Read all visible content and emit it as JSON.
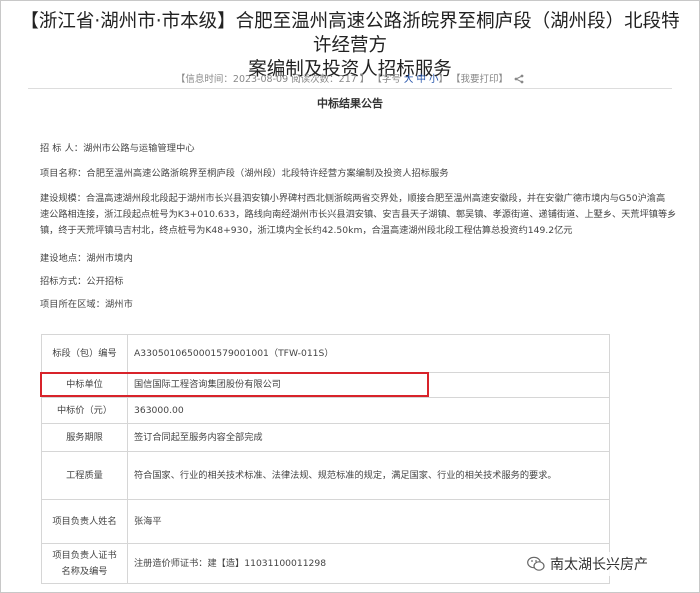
{
  "article": {
    "title_line1": "【浙江省·湖州市·市本级】合肥至温州高速公路浙皖界至桐庐段（湖州段）北段特许经营方",
    "title_line2": "案编制及投资人招标服务",
    "meta": {
      "info_time": "【信息时间：2023-08-09",
      "views": "阅读次数：217 】",
      "font_prefix": "【字号",
      "font_large": "大",
      "font_medium": "中",
      "font_small": "小",
      "font_suffix": "】",
      "print": "【我要打印】"
    },
    "notice_title": "中标结果公告"
  },
  "fields": {
    "tenderer": "招  标  人：湖州市公路与运输管理中心",
    "project_name": "项目名称：合肥至温州高速公路浙皖界至桐庐段（湖州段）北段特许经营方案编制及投资人招标服务",
    "scale_lines": [
      "建设规模：合温高速湖州段北段起于湖州市长兴县泗安镇小界碑村西北侧浙皖两省交界处，顺接合肥至温州高速安徽段，并在安徽广德市境内与G50沪渝高",
      "速公路相连接，浙江段起点桩号为K3+010.633，路线向南经湖州市长兴县泗安镇、安吉县天子湖镇、鄣吴镇、孝源街道、递铺街道、上墅乡、天荒坪镇等乡",
      "镇，终于天荒坪镇马吉村北，终点桩号为K48+930，浙江境内全长约42.50km，合温高速湖州段北段工程估算总投资约149.2亿元"
    ],
    "location": "建设地点：湖州市境内",
    "method": "招标方式：公开招标",
    "region": "项目所在区域：湖州市"
  },
  "result_table": [
    {
      "key": "标段（包）编号",
      "value": "A3305010650001579001001（TFW-011S）"
    },
    {
      "key": "中标单位",
      "value": "国信国际工程咨询集团股份有限公司"
    },
    {
      "key": "中标价（元）",
      "value": "363000.00"
    },
    {
      "key": "服务期限",
      "value": "签订合同起至服务内容全部完成"
    },
    {
      "key": "工程质量",
      "value": "符合国家、行业的相关技术标准、法律法规、规范标准的规定，满足国家、行业的相关技术服务的要求。"
    },
    {
      "key": "项目负责人姓名",
      "value": "张海平"
    },
    {
      "key": "项目负责人证书名称及编号",
      "value": "注册造价师证书：建【造】11031100011298"
    }
  ],
  "watermark": {
    "text": "南太湖长兴房产",
    "icon": "wechat-icon"
  },
  "colors": {
    "highlight": "#d8232a",
    "link": "#1f4fa8"
  }
}
